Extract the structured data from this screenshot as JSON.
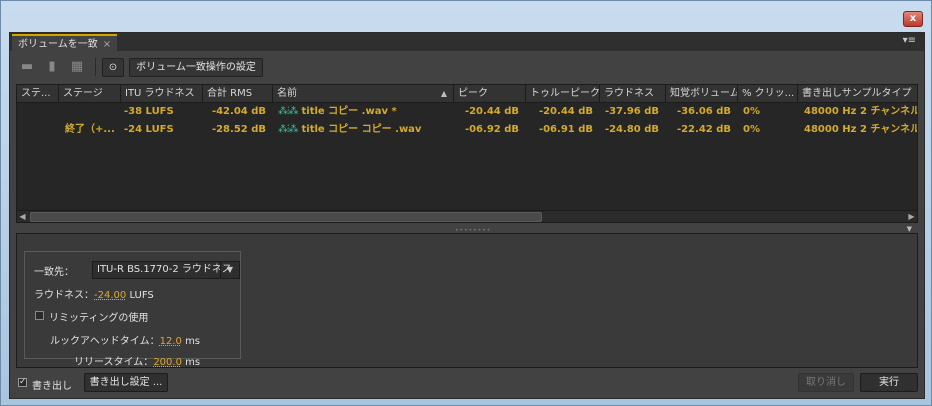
{
  "window": {
    "close_label": "x"
  },
  "tab": {
    "label": "ボリュームを一致",
    "close_label": "×",
    "menu_label": "▾≡"
  },
  "toolbar": {
    "icons": [
      "folder-icon",
      "trash-icon",
      "delete-all-icon",
      "loudness-scan-icon"
    ],
    "match_settings_label": "ボリューム一致操作の設定"
  },
  "columns": [
    "ステ...",
    "ステージ",
    "ITU ラウドネス",
    "合計 RMS",
    "名前",
    "ピーク",
    "トゥルーピーク",
    "ラウドネス",
    "知覚ボリューム",
    "% クリッ...",
    "書き出しサンプルタイプ"
  ],
  "sort_indicator": "▲",
  "rows": [
    {
      "status": "",
      "stage": "",
      "itu": "-38 LUFS",
      "rms": "-42.04 dB",
      "name": "title コピー .wav *",
      "peak": "-20.44 dB",
      "true_peak": "-20.44 dB",
      "loudness": "-37.96 dB",
      "perceived": "-36.06 dB",
      "clip": "0%",
      "sample_type": "48000 Hz 2 チャンネル、"
    },
    {
      "status": "",
      "stage": "終了（+...",
      "itu": "-24 LUFS",
      "rms": "-28.52 dB",
      "name": "title コピー コピー .wav",
      "peak": "-06.92 dB",
      "true_peak": "-06.91 dB",
      "loudness": "-24.80 dB",
      "perceived": "-22.42 dB",
      "clip": "0%",
      "sample_type": "48000 Hz 2 チャンネル、"
    }
  ],
  "settings": {
    "match_to_label": "一致先：",
    "match_to_value": "ITU-R BS.1770-2 ラウドネス",
    "loudness_label": "ラウドネス：",
    "loudness_value": "-24.00",
    "loudness_unit": "LUFS",
    "limiting_label": "リミッティングの使用",
    "limiting_checked": false,
    "lookahead_label": "ルックアヘッドタイム：",
    "lookahead_value": "12.0",
    "lookahead_unit": "ms",
    "release_label": "リリースタイム：",
    "release_value": "200.0",
    "release_unit": "ms"
  },
  "footer": {
    "export_check": "✓",
    "export_label": "書き出し",
    "export_settings_label": "書き出し設定 ...",
    "cancel_label": "取り消し",
    "run_label": "実行"
  },
  "colors": {
    "accent": "#d8a000",
    "value_text": "#d4aa2c",
    "waveform": "#3fc3a0"
  }
}
